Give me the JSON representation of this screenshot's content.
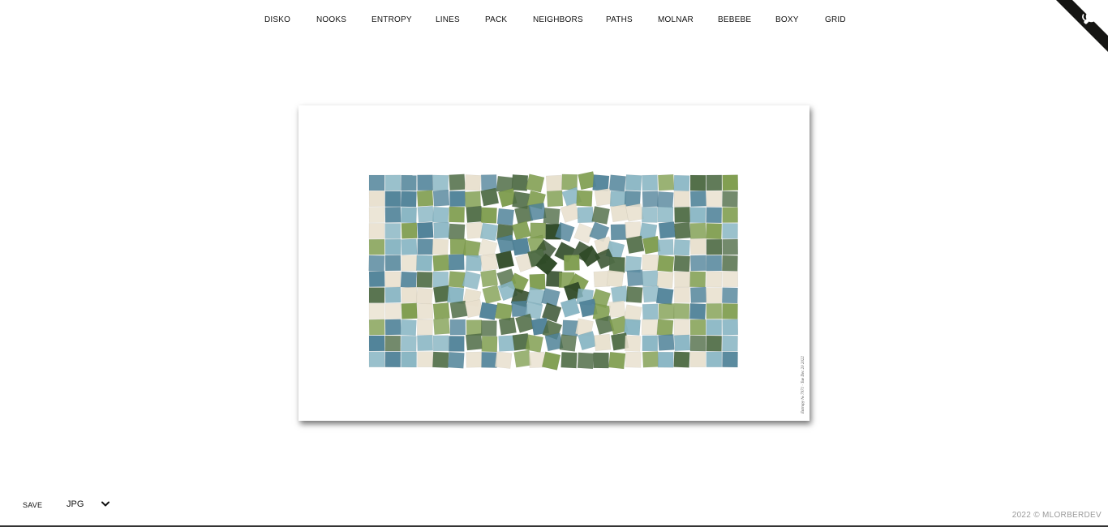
{
  "nav": {
    "items": [
      "DISKO",
      "NOOKS",
      "ENTROPY",
      "LINES",
      "PACK",
      "NEIGHBORS",
      "PATHS",
      "MOLNAR",
      "BEBEBE",
      "BOXY",
      "GRID"
    ]
  },
  "corner": {
    "icon": "github-octocat-icon"
  },
  "artwork": {
    "palette": [
      "#e8e0ce",
      "#4e6b44",
      "#7f9d4f",
      "#4f8298",
      "#86b4c2",
      "#2f4a27"
    ],
    "signature": "Entropy № 7971 · Tue Dec 20 2022"
  },
  "controls": {
    "save_label": "SAVE",
    "format_value": "JPG",
    "format_icon": "chevron-down-icon"
  },
  "footer": {
    "text": "2022 © MLORBERDEV"
  }
}
